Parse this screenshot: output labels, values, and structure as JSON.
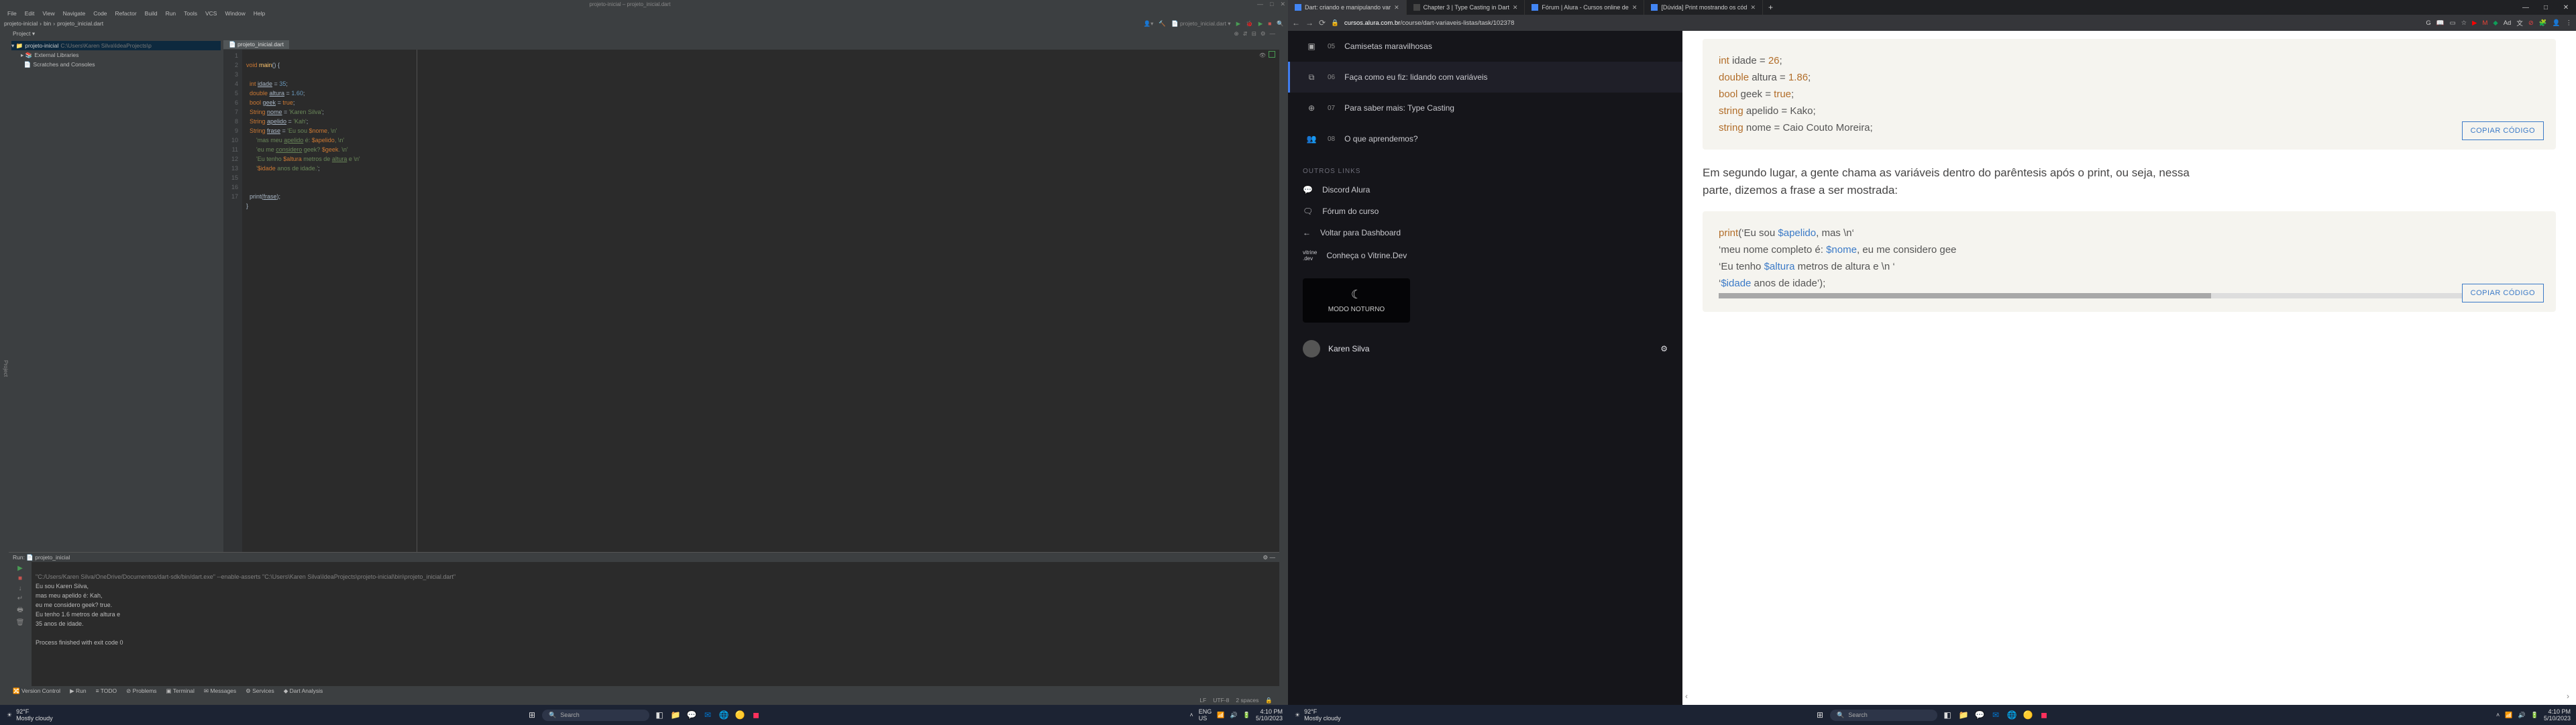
{
  "ide": {
    "title_center": "projeto-inicial – projeto_inicial.dart",
    "menu": [
      "File",
      "Edit",
      "View",
      "Navigate",
      "Code",
      "Refactor",
      "Build",
      "Run",
      "Tools",
      "VCS",
      "Window",
      "Help"
    ],
    "breadcrumb": {
      "a": "projeto-inicial",
      "b": "bin",
      "c": "projeto_inicial.dart"
    },
    "run_config": "projeto_inicial.dart",
    "project_label": "Project",
    "tree": {
      "root_name": "projeto-inicial",
      "root_path": "C:\\Users\\Karen Silva\\IdeaProjects\\p",
      "ext_lib": "External Libraries",
      "scratches": "Scratches and Consoles"
    },
    "editor_tab": "projeto_inicial.dart",
    "gutter_lines": [
      "1",
      "2",
      "3",
      "4",
      "5",
      "6",
      "7",
      "8",
      "9",
      "10",
      "11",
      "12",
      "13",
      "",
      "15",
      "16",
      "17"
    ],
    "code": {
      "l1a": "void ",
      "l1b": "main",
      "l1c": "() {",
      "l2": "",
      "l3a": "  int ",
      "l3b": "idade",
      "l3c": " = ",
      "l3d": "35",
      "l3e": ";",
      "l4a": "  double ",
      "l4b": "altura",
      "l4c": " = ",
      "l4d": "1.60",
      "l4e": ";",
      "l5a": "  bool ",
      "l5b": "geek",
      "l5c": " = ",
      "l5d": "true",
      "l5e": ";",
      "l6a": "  String ",
      "l6b": "nome",
      "l6c": " = ",
      "l6d": "'Karen Silva'",
      "l6e": ";",
      "l7a": "  String ",
      "l7b": "apelido",
      "l7c": " = ",
      "l7d": "'Kah'",
      "l7e": ";",
      "l8a": "  String ",
      "l8b": "frase",
      "l8c": " = ",
      "l8d": "'Eu sou ",
      "l8e": "$nome",
      "l8f": ", \\n'",
      "l9a": "      'mas meu ",
      "l9b": "apelido",
      "l9c": " é: ",
      "l9d": "$apelido",
      "l9e": ", \\n'",
      "l10a": "      'eu me ",
      "l10b": "considero",
      "l10c": " geek? ",
      "l10d": "$geek",
      "l10e": ". \\n'",
      "l11a": "      'Eu tenho ",
      "l11b": "$altura",
      "l11c": " metros de ",
      "l11d": "altura",
      "l11e": " e \\n'",
      "l12a": "      '",
      "l12b": "$idade",
      "l12c": " anos de idade.'",
      "l12d": ";",
      "l13": "",
      "l14": "",
      "l15a": "  print(",
      "l15b": "frase",
      "l15c": ");",
      "l16": "}",
      "l17": ""
    },
    "run_tab_label": "Run:",
    "run_tab_file": "projeto_inicial",
    "console": {
      "cmd": "\"C:/Users/Karen Silva/OneDrive/Documentos/dart-sdk/bin/dart.exe\" --enable-asserts \"C:\\Users\\Karen Silva\\IdeaProjects\\projeto-inicial\\bin\\projeto_inicial.dart\"",
      "o1": "Eu sou Karen Silva,",
      "o2": "mas meu apelido é: Kah,",
      "o3": "eu me considero geek? true.",
      "o4": "Eu tenho 1.6 metros de altura e",
      "o5": "35 anos de idade.",
      "o6": "",
      "o7": "Process finished with exit code 0"
    },
    "bottom_items": [
      "Version Control",
      "Run",
      "TODO",
      "Problems",
      "Terminal",
      "Messages",
      "Services",
      "Dart Analysis"
    ],
    "status": {
      "lf": "LF",
      "enc": "UTF-8",
      "spaces": "2 spaces"
    }
  },
  "browser": {
    "tabs": [
      {
        "label": "Dart: criando e manipulando var"
      },
      {
        "label": "Chapter 3 | Type Casting in Dart"
      },
      {
        "label": "Fórum | Alura - Cursos online de"
      },
      {
        "label": "[Dúvida] Print mostrando os cód"
      }
    ],
    "url_host": "cursos.alura.com.br",
    "url_path": "/course/dart-variaveis-listas/task/102378",
    "sidebar": {
      "items": [
        {
          "num": "05",
          "label": "Camisetas maravilhosas"
        },
        {
          "num": "06",
          "label": "Faça como eu fiz: lidando com variáveis"
        },
        {
          "num": "07",
          "label": "Para saber mais: Type Casting"
        },
        {
          "num": "08",
          "label": "O que aprendemos?"
        }
      ],
      "heading": "OUTROS LINKS",
      "links": [
        "Discord Alura",
        "Fórum do curso",
        "Voltar para Dashboard",
        "Conheça o Vitrine.Dev"
      ],
      "modo": "MODO NOTURNO",
      "user": "Karen Silva"
    },
    "code1": {
      "l1a": "int",
      "l1b": " idade = ",
      "l1c": "26",
      "l1d": ";",
      "l2a": "double",
      "l2b": " altura = ",
      "l2c": "1.86",
      "l2d": ";",
      "l3a": "bool",
      "l3b": " geek = ",
      "l3c": "true",
      "l3d": ";",
      "l4a": "string",
      "l4b": " apelido = Kako;",
      "l5a": "string",
      "l5b": " nome = Caio Couto Moreira;"
    },
    "copy": "COPIAR CÓDIGO",
    "prose": "Em segundo lugar, a gente chama as variáveis dentro do parêntesis após o print, ou seja, nessa parte, dizemos a frase a ser mostrada:",
    "code2": {
      "l1a": "print",
      "l1b": "(‘Eu sou ",
      "l1c": "$apelido",
      "l1d": ", mas \\n‘",
      "l2a": "‘meu nome completo é: ",
      "l2b": "$nome",
      "l2c": ", eu me considero gee",
      "l3a": "‘Eu tenho ",
      "l3b": "$altura",
      "l3c": " metros de altura e \\n ‘",
      "l4a": "‘",
      "l4b": "$idade",
      "l4c": " anos de idade’);"
    }
  },
  "taskbar_left": {
    "temp": "92°F",
    "cond": "Mostly cloudy",
    "lang1": "ENG",
    "lang2": "US",
    "time": "4:10 PM",
    "date": "5/10/2023",
    "search": "Search"
  },
  "taskbar_right": {
    "temp": "92°F",
    "cond": "Mostly cloudy",
    "time": "4:10 PM",
    "date": "5/10/2023",
    "search": "Search"
  }
}
